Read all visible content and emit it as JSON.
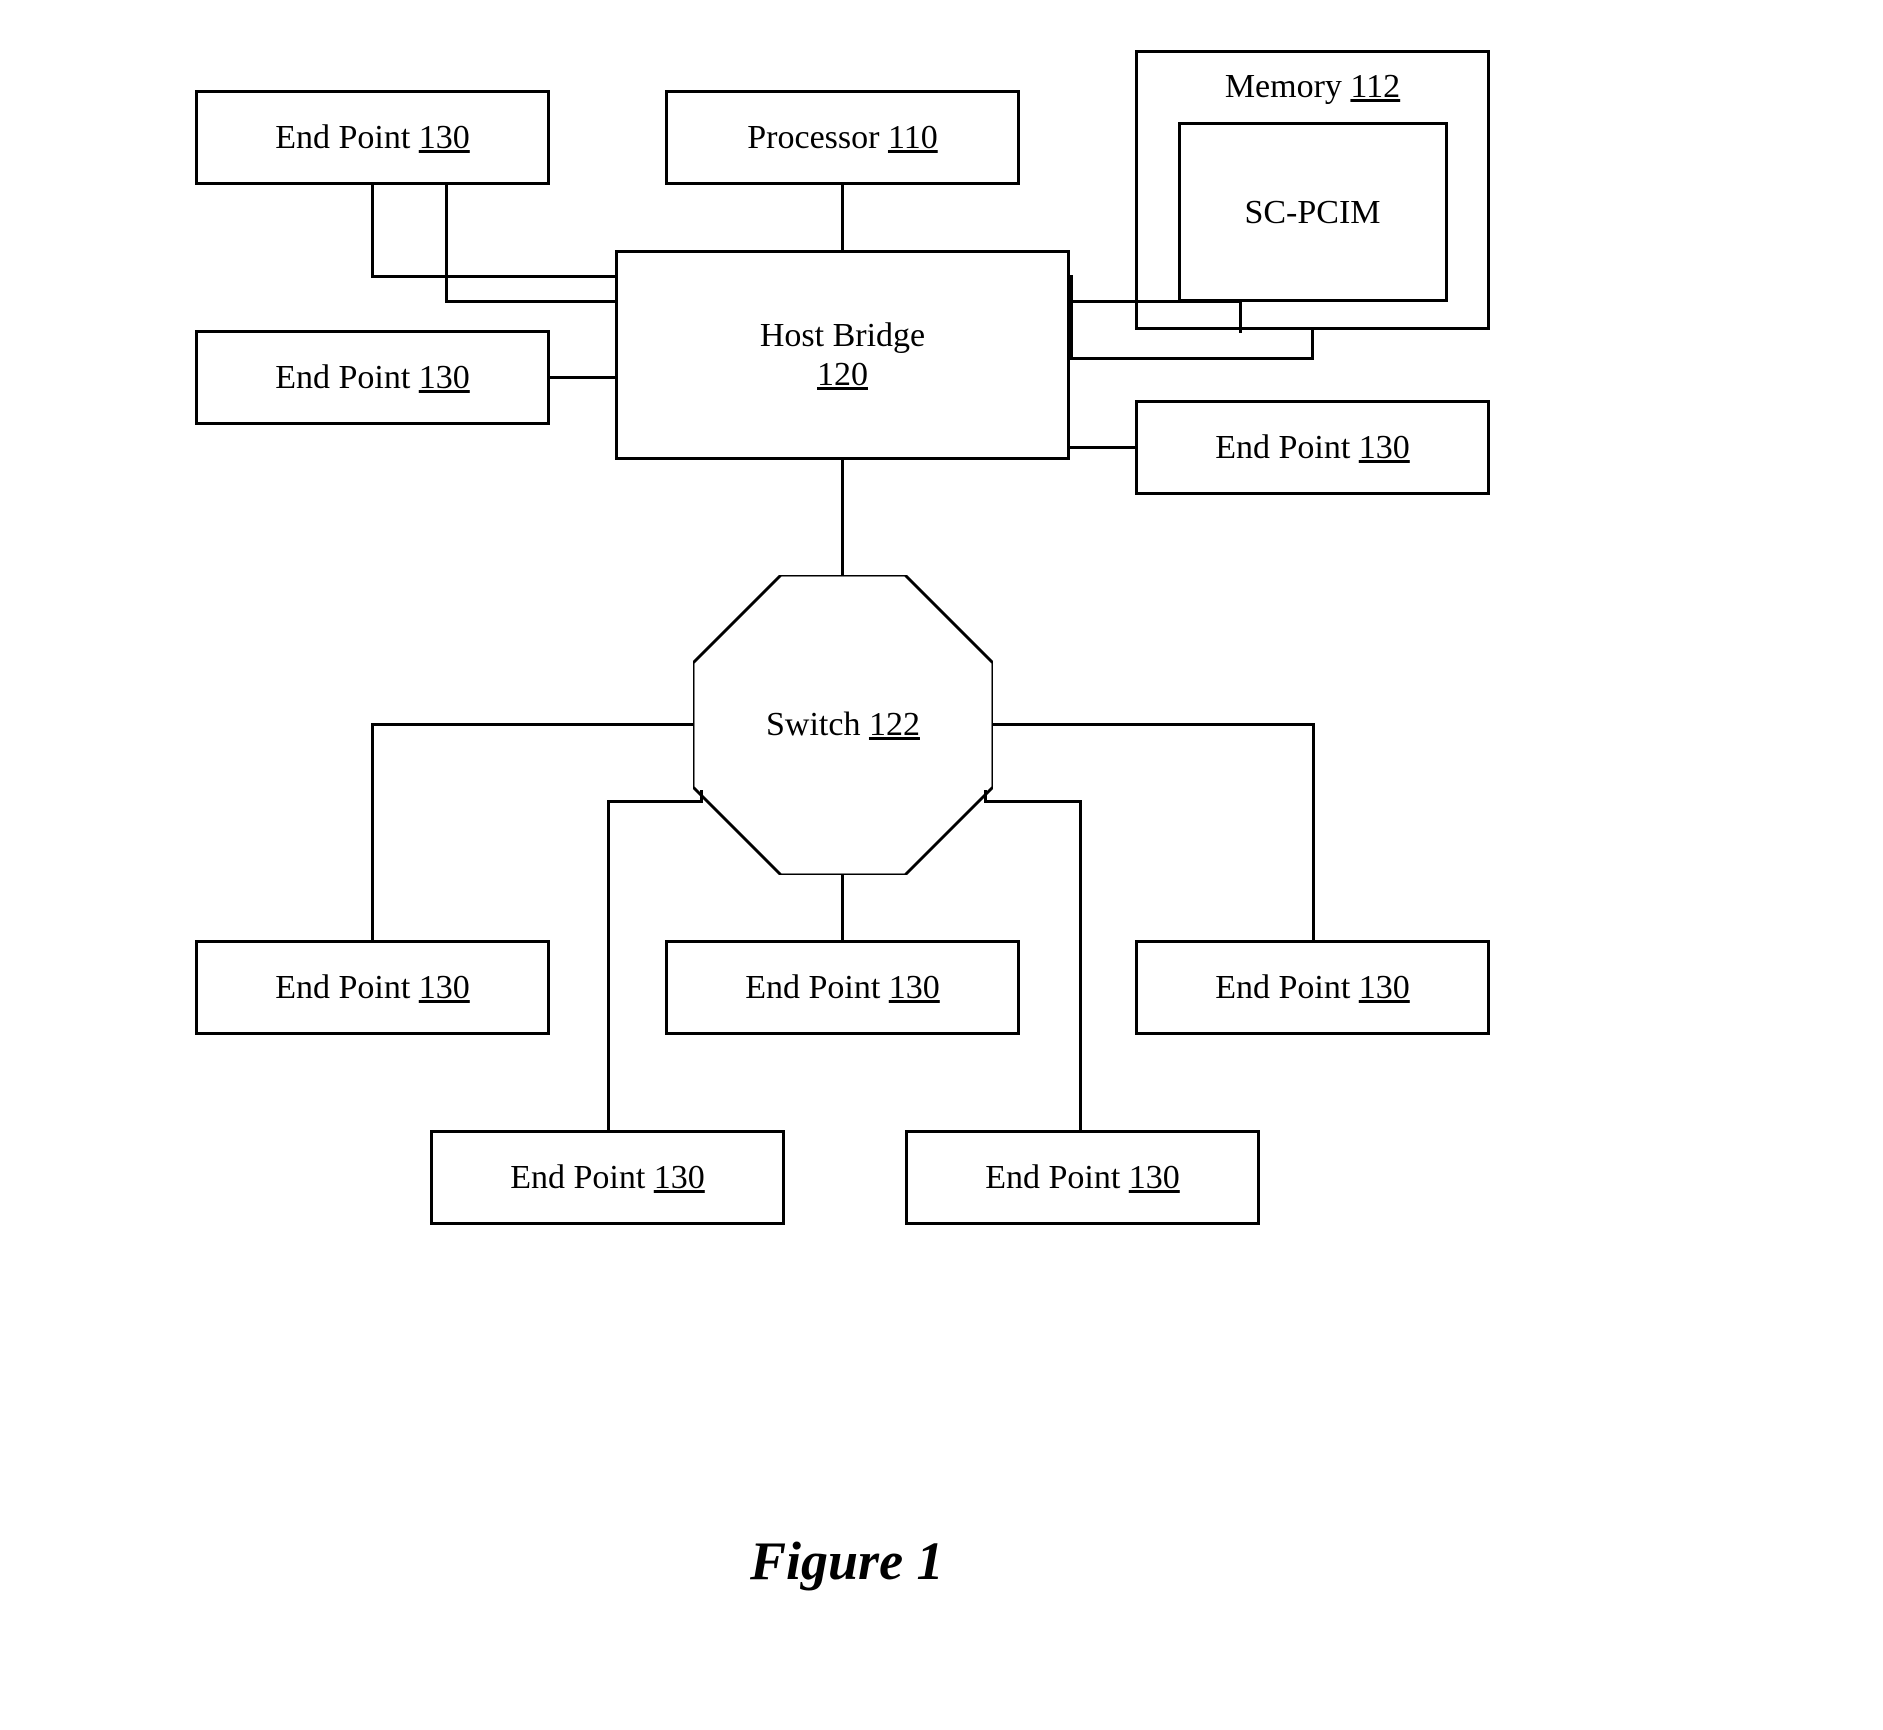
{
  "nodes": {
    "processor": {
      "text": "Processor ",
      "num": "110"
    },
    "memory": {
      "text": "Memory ",
      "num": "112"
    },
    "sc_pcim": {
      "text": "SC-PCIM",
      "num": ""
    },
    "host_bridge": {
      "text": "Host Bridge",
      "num": "120"
    },
    "switch": {
      "text": "Switch ",
      "num": "122"
    },
    "ep": {
      "text": "End Point ",
      "num": "130"
    }
  },
  "caption": "Figure 1"
}
